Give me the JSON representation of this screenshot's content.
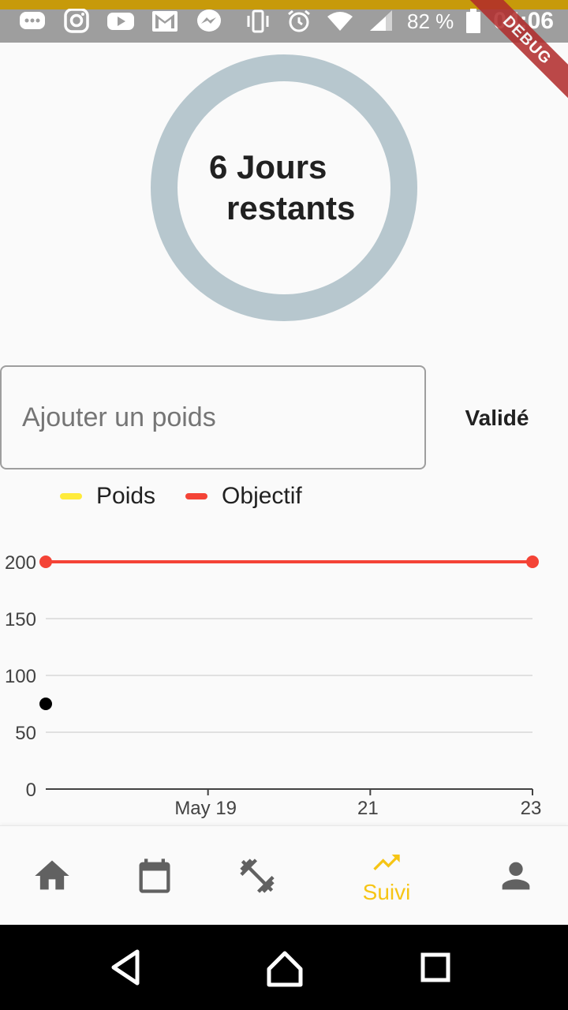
{
  "status_bar": {
    "icons": [
      "message-icon",
      "instagram-icon",
      "youtube-icon",
      "gmail-icon",
      "messenger-icon"
    ],
    "right_icons": [
      "vibrate-icon",
      "alarm-icon",
      "wifi-icon",
      "signal-icon",
      "battery-icon"
    ],
    "battery": "82 %",
    "time": "04:06",
    "accent_color": "#c79a0a"
  },
  "debug_banner": "DEBUG",
  "countdown": {
    "line1": "6 Jours",
    "line2": "restants",
    "ring_color": "#b7c7ce"
  },
  "weight_form": {
    "placeholder": "Ajouter un poids",
    "value": "",
    "submit_label": "Validé"
  },
  "legend": [
    {
      "label": "Poids",
      "color": "#ffeb3b"
    },
    {
      "label": "Objectif",
      "color": "#f44336"
    }
  ],
  "chart_data": {
    "type": "line",
    "x_ticks": [
      "May 19",
      "21",
      "23"
    ],
    "y_ticks": [
      "200",
      "150",
      "100",
      "50",
      "0"
    ],
    "ylim": [
      0,
      200
    ],
    "series": [
      {
        "name": "Poids",
        "color": "#000000",
        "points": [
          {
            "x": "2023-05-17",
            "y": 75
          }
        ]
      },
      {
        "name": "Objectif",
        "color": "#f44336",
        "points": [
          {
            "x": "2023-05-17",
            "y": 200
          },
          {
            "x": "2023-05-23",
            "y": 200
          }
        ]
      }
    ]
  },
  "bottom_nav": {
    "items": [
      {
        "icon": "home-icon",
        "label": ""
      },
      {
        "icon": "calendar-icon",
        "label": ""
      },
      {
        "icon": "dumbbell-icon",
        "label": ""
      },
      {
        "icon": "trending-up-icon",
        "label": "Suivi",
        "active": true
      },
      {
        "icon": "person-icon",
        "label": ""
      }
    ],
    "active_color": "#f6c515",
    "inactive_color": "#616161"
  },
  "system_nav": [
    "back-icon",
    "home-circle-icon",
    "recents-icon"
  ]
}
